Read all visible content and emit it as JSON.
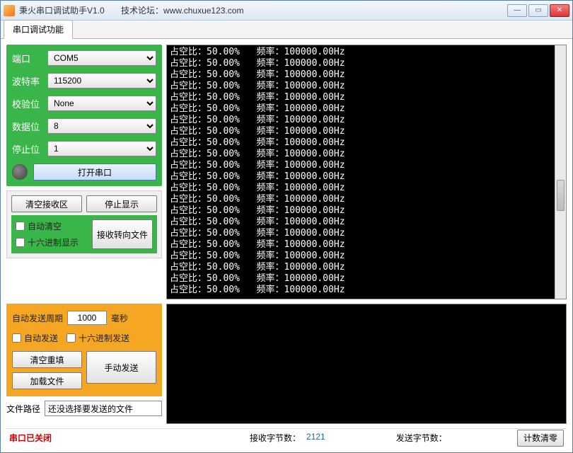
{
  "window": {
    "title": "秉火串口调试助手V1.0",
    "forum_label": "技术论坛：",
    "forum_url": "www.chuxue123.com"
  },
  "tabs": {
    "main": "串口调试功能"
  },
  "config": {
    "port_label": "端口",
    "port_value": "COM5",
    "baud_label": "波特率",
    "baud_value": "115200",
    "parity_label": "校验位",
    "parity_value": "None",
    "databits_label": "数据位",
    "databits_value": "8",
    "stopbits_label": "停止位",
    "stopbits_value": "1",
    "open_btn": "打开串口"
  },
  "recv_ctrl": {
    "clear_btn": "清空接收区",
    "stop_btn": "停止显示",
    "auto_clear": "自动清空",
    "hex_display": "十六进制显示",
    "to_file_btn": "接收转向文件"
  },
  "terminal_line": "占空比：50.00%   频率：100000.00Hz",
  "terminal_line_count": 22,
  "send": {
    "period_label": "自动发送周期",
    "period_value": "1000",
    "period_unit": "毫秒",
    "auto_send": "自动发送",
    "hex_send": "十六进制发送",
    "clear_fill_btn": "清空重填",
    "load_file_btn": "加载文件",
    "manual_send_btn": "手动发送",
    "filepath_label": "文件路径",
    "filepath_value": "还没选择要发送的文件"
  },
  "status": {
    "port_state": "串口已关闭",
    "recv_bytes_label": "接收字节数：",
    "recv_bytes_value": "2121",
    "send_bytes_label": "发送字节数：",
    "send_bytes_value": "",
    "reset_btn": "计数清零"
  }
}
